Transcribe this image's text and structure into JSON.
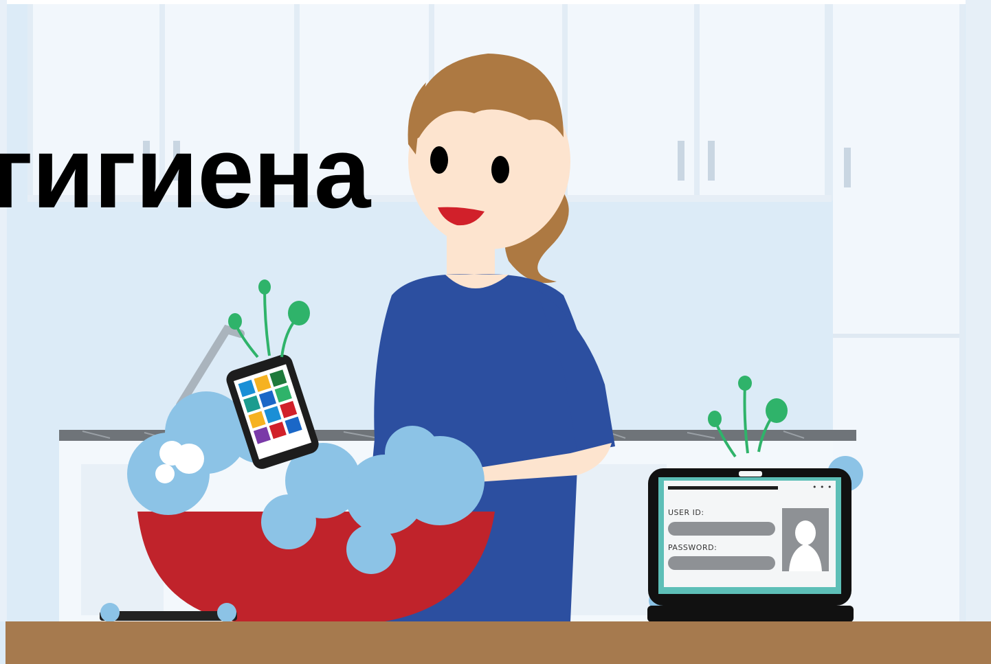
{
  "headline": "гигиена",
  "laptop_screen": {
    "user_id_label": "USER ID:",
    "password_label": "PASSWORD:",
    "menu_dots": "• • •"
  },
  "colors": {
    "wall": "#dcebf7",
    "cabinet": "#f3f8fc",
    "counter": "#a67a4e",
    "dress": "#2c4fa0",
    "hair": "#ad7942",
    "bowl": "#c0232b",
    "foam": "#8cc3e6",
    "germs": "#2fb36a",
    "laptop_screen": "#5dbfb7"
  },
  "icons": [
    "germ-icon",
    "tablet-icon",
    "laptop-icon",
    "avatar-silhouette-icon"
  ]
}
